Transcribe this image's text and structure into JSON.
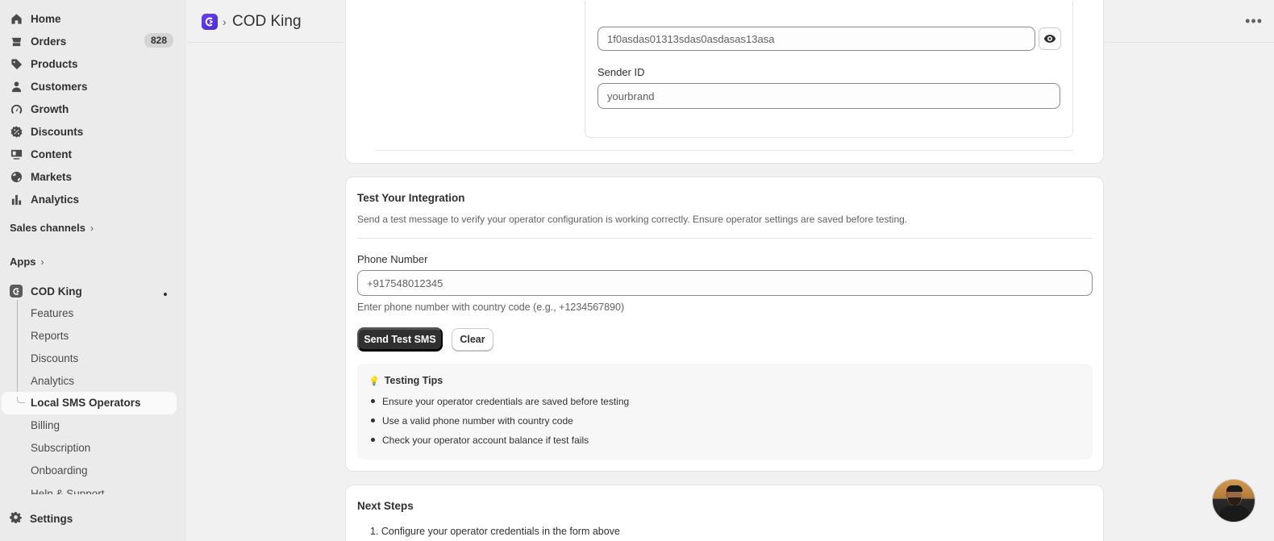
{
  "sidebar": {
    "nav": [
      {
        "label": "Home",
        "icon": "home-icon"
      },
      {
        "label": "Orders",
        "icon": "orders-icon",
        "badge": "828"
      },
      {
        "label": "Products",
        "icon": "tag-icon"
      },
      {
        "label": "Customers",
        "icon": "person-icon"
      },
      {
        "label": "Growth",
        "icon": "gauge-icon"
      },
      {
        "label": "Discounts",
        "icon": "discount-icon"
      },
      {
        "label": "Content",
        "icon": "content-icon"
      },
      {
        "label": "Markets",
        "icon": "globe-icon"
      },
      {
        "label": "Analytics",
        "icon": "bar-chart-icon"
      }
    ],
    "sales_channels": "Sales channels",
    "apps": "Apps",
    "app_name": "COD King",
    "app_subitems": [
      "Features",
      "Reports",
      "Discounts",
      "Analytics",
      "Local SMS Operators",
      "Billing",
      "Subscription",
      "Onboarding"
    ],
    "partial_item": "Help & Support",
    "settings": "Settings"
  },
  "header": {
    "title": "COD King",
    "separator": "›",
    "more": "•••"
  },
  "operator_card": {
    "api_key_value": "1f0asdas01313sdas0asdasas13asa",
    "sender_label": "Sender ID",
    "sender_placeholder": "yourbrand"
  },
  "test_card": {
    "title": "Test Your Integration",
    "description": "Send a test message to verify your operator configuration is working correctly. Ensure operator settings are saved before testing.",
    "phone_label": "Phone Number",
    "phone_value": "+917548012345",
    "phone_help": "Enter phone number with country code (e.g., +1234567890)",
    "send_button": "Send Test SMS",
    "clear_button": "Clear",
    "tips_title": "Testing Tips",
    "tips": [
      "Ensure your operator credentials are saved before testing",
      "Use a valid phone number with country code",
      "Check your operator account balance if test fails"
    ]
  },
  "next_card": {
    "title": "Next Steps",
    "steps": [
      "1. Configure your operator credentials in the form above"
    ]
  }
}
